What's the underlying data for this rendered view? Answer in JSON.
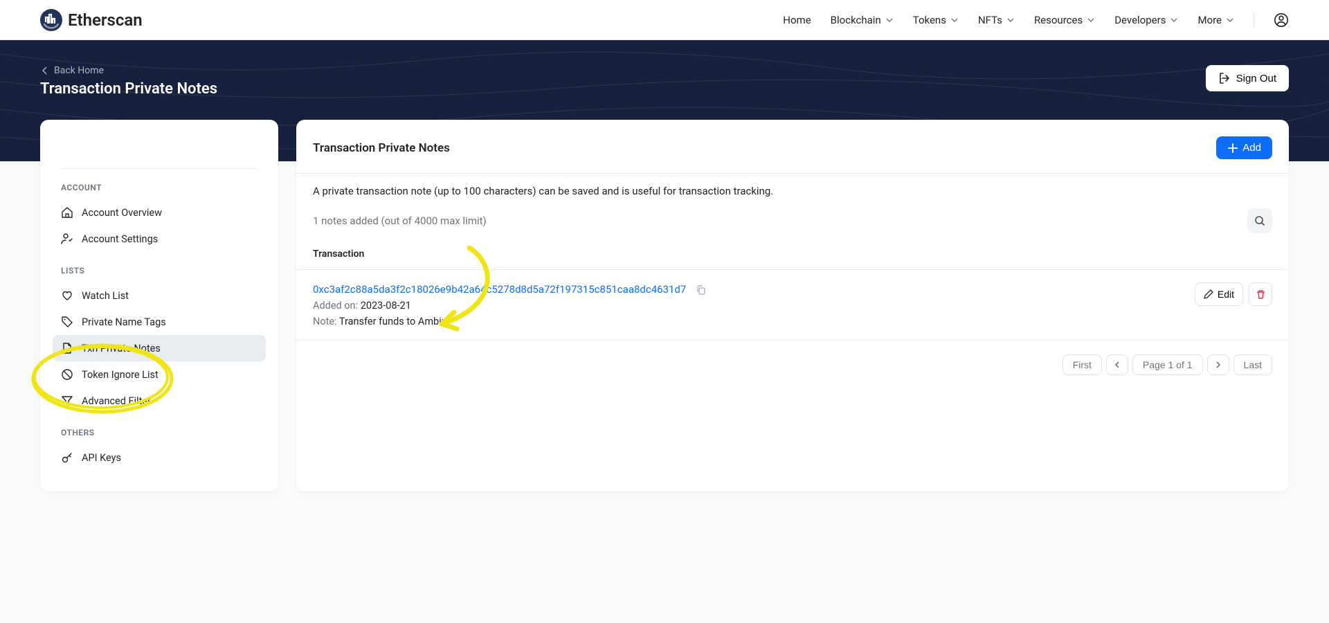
{
  "header": {
    "brand": "Etherscan",
    "nav": [
      "Home",
      "Blockchain",
      "Tokens",
      "NFTs",
      "Resources",
      "Developers",
      "More"
    ]
  },
  "hero": {
    "back_label": "Back Home",
    "title": "Transaction Private Notes",
    "signout_label": "Sign Out"
  },
  "sidebar": {
    "sections": {
      "account": {
        "title": "ACCOUNT",
        "items": [
          "Account Overview",
          "Account Settings"
        ]
      },
      "lists": {
        "title": "LISTS",
        "items": [
          "Watch List",
          "Private Name Tags",
          "Txn Private Notes",
          "Token Ignore List",
          "Advanced Filter"
        ]
      },
      "others": {
        "title": "OTHERS",
        "items": [
          "API Keys"
        ]
      }
    }
  },
  "content": {
    "title": "Transaction Private Notes",
    "add_label": "Add",
    "description": "A private transaction note (up to 100 characters) can be saved and is useful for transaction tracking.",
    "count_text": "1 notes added (out of 4000 max limit)",
    "table_header": "Transaction",
    "note": {
      "hash": "0xc3af2c88a5da3f2c18026e9b42a64c5278d8d5a72f197315c851caa8dc4631d7",
      "added_label": "Added on:",
      "added_date": "2023-08-21",
      "note_label": "Note:",
      "note_text": "Transfer funds to Ambire",
      "edit_label": "Edit"
    },
    "pagination": {
      "first": "First",
      "info": "Page 1 of 1",
      "last": "Last"
    }
  }
}
